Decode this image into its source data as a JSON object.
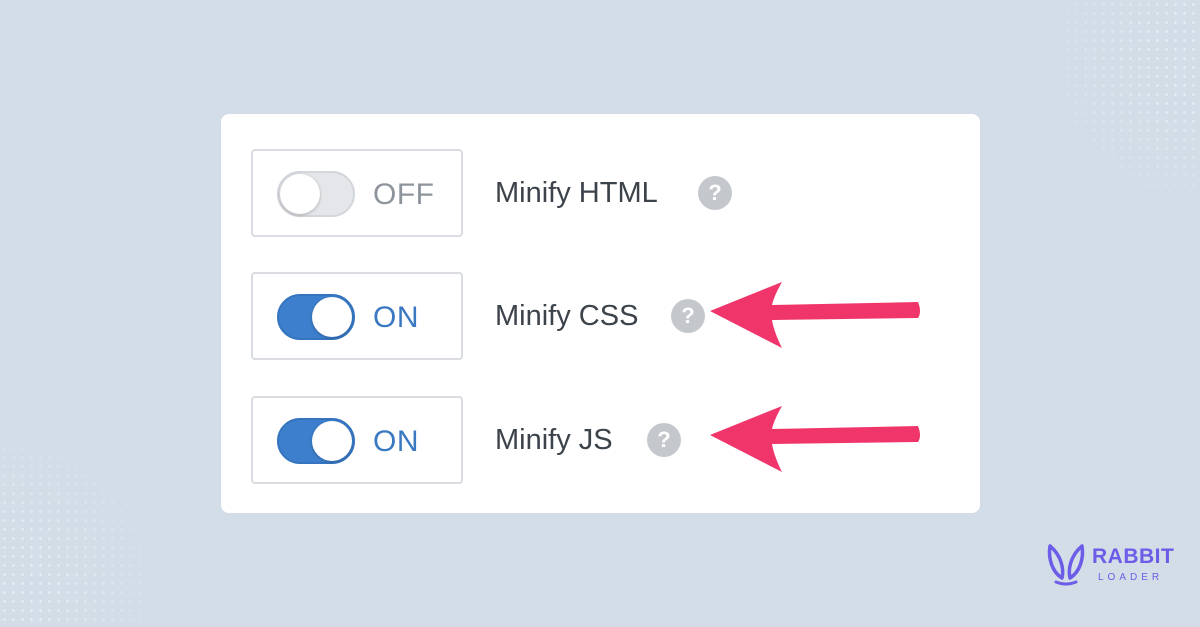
{
  "settings": [
    {
      "id": "html",
      "label": "Minify HTML",
      "state": "OFF",
      "enabled": false
    },
    {
      "id": "css",
      "label": "Minify CSS",
      "state": "ON",
      "enabled": true
    },
    {
      "id": "js",
      "label": "Minify JS",
      "state": "ON",
      "enabled": true
    }
  ],
  "help_icon": {
    "glyph": "?",
    "icon": "question-circle-icon"
  },
  "annotations": {
    "arrow_color": "#f0356a",
    "icon": "arrow-left-icon"
  },
  "brand": {
    "name": "RABBIT",
    "sub": "LOADER",
    "color": "#6c5ce7",
    "icon": "rabbit-ears-icon"
  },
  "colors": {
    "background": "#d2dde8",
    "card": "#ffffff",
    "toggle_on": "#3d7fcc",
    "toggle_off": "#e4e6e9",
    "on_text": "#3a78c2",
    "off_text": "#8d949c",
    "label_text": "#3c434b",
    "help_icon": "#c4c8cd"
  }
}
